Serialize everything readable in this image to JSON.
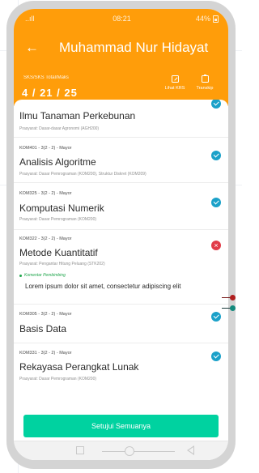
{
  "status_bar": {
    "signal": "..ıll",
    "time": "08:21",
    "battery": "44%"
  },
  "header": {
    "back_icon": "arrow-left-icon",
    "title": "Muhammad Nur Hidayat",
    "sks_label": "SKS/SKS Total/Maks",
    "sks_value": "4 / 21 / 25",
    "krs_label": "Lihat KRS",
    "transkrip_label": "Transkip"
  },
  "courses": [
    {
      "code": "",
      "name": "Ilmu Tanaman Perkebunan",
      "prereq": "Prasyarat: Dasar-dasar Agronomi (AGH200)",
      "status": "approved"
    },
    {
      "code": "KOM401 - 3(2 - 2) - Mayor",
      "name": "Analisis Algoritme",
      "prereq": "Prasyarat: Dasar Pemrograman (KOM200), Struktur Diskret (KOM209)",
      "status": "approved"
    },
    {
      "code": "KOM325 - 3(2 - 2) - Mayor",
      "name": "Komputasi Numerik",
      "prereq": "Prasyarat: Dasar Pemrograman (KOM200)",
      "status": "approved"
    },
    {
      "code": "KOM322 - 3(2 - 2) - Mayor",
      "name": "Metode Kuantitatif",
      "prereq": "Prasyarat: Pengantar Hitung Peluang (STK202)",
      "status": "rejected",
      "comment_label": "Komentar Pembimbing",
      "comment": "Lorem ipsum dolor sit amet, consectetur adipiscing elit"
    },
    {
      "code": "KOM305 - 3(2 - 2) - Mayor",
      "name": "Basis Data",
      "prereq": "",
      "status": "approved"
    },
    {
      "code": "KOM331 - 3(2 - 2) - Mayor",
      "name": "Rekayasa Perangkat Lunak",
      "prereq": "Prasyarat: Dasar Pemrograman (KOM200)",
      "status": "approved"
    }
  ],
  "approve_button": "Setujui Semuanya",
  "colors": {
    "header": "#ff9d0a",
    "approve": "#00d2a0",
    "check": "#1ba1c9",
    "reject": "#e13b48",
    "comment": "#1fa54b"
  }
}
